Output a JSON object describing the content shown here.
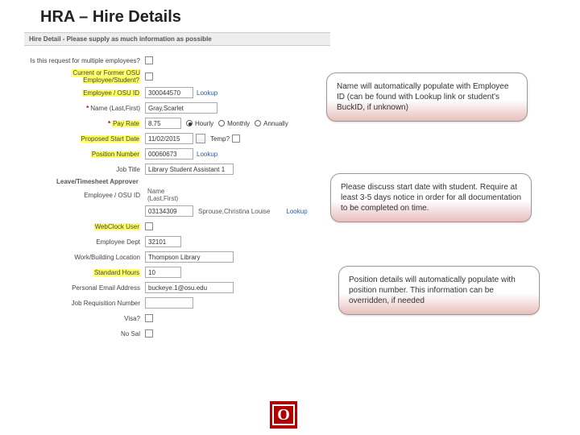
{
  "title": "HRA – Hire Details",
  "header": "Hire Detail - Please supply as much information as possible",
  "labels": {
    "multi": "Is this request for multiple employees?",
    "current": "Current or Former OSU Employee/Student?",
    "empId": "Employee / OSU ID",
    "name": "Name (Last,First)",
    "payRate": "Pay Rate",
    "startDate": "Proposed Start Date",
    "temp": "Temp?",
    "posNum": "Position Number",
    "jobTitle": "Job Title",
    "approverHdr": "Leave/Timesheet Approver",
    "approverId": "Employee / OSU ID",
    "approverName": "Name (Last,First)",
    "webclock": "WebClock User",
    "dept": "Employee Dept",
    "workLoc": "Work/Building Location",
    "stdHours": "Standard Hours",
    "email": "Personal Email Address",
    "jobReq": "Job Requisition Number",
    "visa": "Visa?",
    "noSal": "No Sal"
  },
  "values": {
    "empId": "300044570",
    "name": "Gray,Scarlet",
    "payRate": "8.75",
    "startDate": "11/02/2015",
    "posNum": "00060673",
    "jobTitle": "Library Student Assistant 1",
    "approverId": "03134309",
    "approverName": "Sprouse,Christina Louise",
    "dept": "32101",
    "workLoc": "Thompson Library",
    "stdHours": "10",
    "email": "buckeye.1@osu.edu",
    "jobReq": ""
  },
  "radios": {
    "hourly": "Hourly",
    "monthly": "Monthly",
    "annually": "Annually"
  },
  "lookup": "Lookup",
  "callouts": {
    "c1": "Name will automatically populate with Employee ID (can be found with Lookup link or student's BuckID, if unknown)",
    "c2": "Please discuss start date with student. Require at least 3-5 days notice in order for all documentation to be completed on time.",
    "c3": "Position details will automatically populate with position number. This information can be overridden, if needed"
  },
  "logo": "O"
}
